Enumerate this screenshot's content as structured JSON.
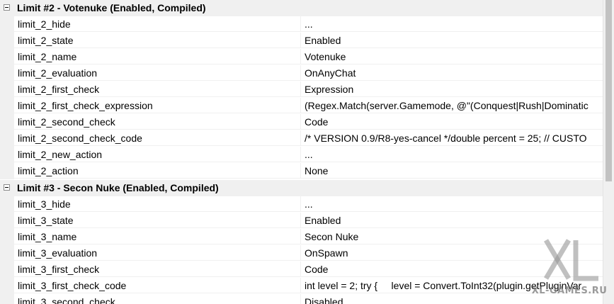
{
  "categories": [
    {
      "title": "Limit #2 - Votenuke (Enabled, Compiled)",
      "rows": [
        {
          "name": "limit_2_hide",
          "value": "..."
        },
        {
          "name": "limit_2_state",
          "value": "Enabled"
        },
        {
          "name": "limit_2_name",
          "value": "Votenuke"
        },
        {
          "name": "limit_2_evaluation",
          "value": "OnAnyChat"
        },
        {
          "name": "limit_2_first_check",
          "value": "Expression"
        },
        {
          "name": "limit_2_first_check_expression",
          "value": "(Regex.Match(server.Gamemode, @\"(Conquest|Rush|Dominatic"
        },
        {
          "name": "limit_2_second_check",
          "value": "Code"
        },
        {
          "name": "limit_2_second_check_code",
          "value": "/* VERSION 0.9/R8-yes-cancel */double percent = 25; // CUSTO"
        },
        {
          "name": "limit_2_new_action",
          "value": "..."
        },
        {
          "name": "limit_2_action",
          "value": "None"
        }
      ]
    },
    {
      "title": "Limit #3 - Secon Nuke (Enabled, Compiled)",
      "rows": [
        {
          "name": "limit_3_hide",
          "value": "..."
        },
        {
          "name": "limit_3_state",
          "value": "Enabled"
        },
        {
          "name": "limit_3_name",
          "value": "Secon Nuke"
        },
        {
          "name": "limit_3_evaluation",
          "value": "OnSpawn"
        },
        {
          "name": "limit_3_first_check",
          "value": "Code"
        },
        {
          "name": "limit_3_first_check_code",
          "value": "int level = 2; try {     level = Convert.ToInt32(plugin.getPluginVar"
        },
        {
          "name": "limit_3_second_check",
          "value": "Disabled"
        }
      ]
    }
  ],
  "watermark": {
    "text": "XL-GAMES.RU",
    "icon": "xl-logo"
  }
}
